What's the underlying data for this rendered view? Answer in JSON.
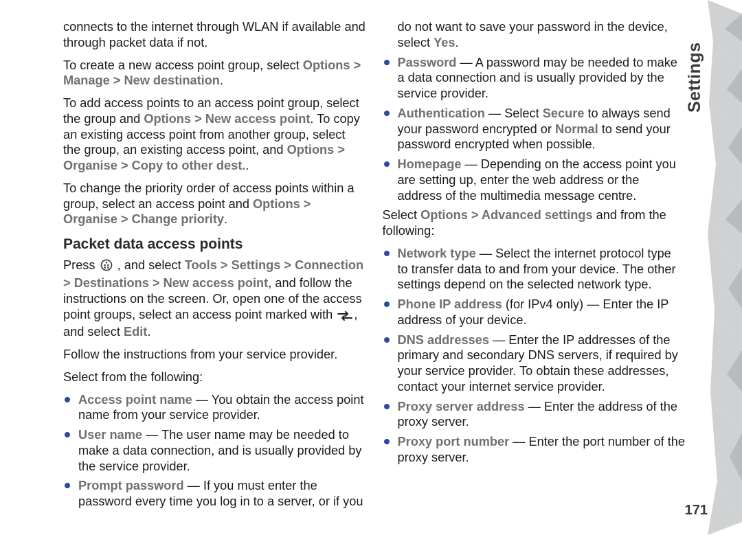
{
  "tab_label": "Settings",
  "page_number": "171",
  "left": {
    "p1": "connects to the internet through WLAN if available and through packet data if not.",
    "p2a": "To create a new access point group, select ",
    "p2b": "Options",
    "p2c": "Manage",
    "p2d": "New destination",
    "p2e": ".",
    "p3a": "To add access points to an access point group, select the group and ",
    "p3b": "Options",
    "p3c": "New access point",
    "p3d": ". To copy an existing access point from another group, select the group, an existing access point, and ",
    "p3e": "Options",
    "p3f": "Organise",
    "p3g": "Copy to other dest.",
    "p3h": ".",
    "p4a": "To change the priority order of access points within a group, select an access point and ",
    "p4b": "Options",
    "p4c": "Organise",
    "p4d": "Change priority",
    "p4e": ".",
    "h1": "Packet data access points",
    "p5a": "Press ",
    "p5b": " , and select ",
    "p5c": "Tools",
    "p5d": "Settings",
    "p5e": "Connection",
    "p5f": "Destinations",
    "p5g": "New access point",
    "p5h": ", and follow the instructions on the screen. Or, open one of the access point groups, select an access point marked with ",
    "p5i": ", and select ",
    "p5j": "Edit",
    "p5k": ".",
    "p6": "Follow the instructions from your service provider.",
    "p7": "Select from the following:",
    "li1a": "Access point name",
    "li1b": " — You obtain the access point name from your service provider.",
    "li2a": "User name",
    "li2b": " — The user name may be needed to make a data connection, and is usually provided by the service provider.",
    "li3a": "Prompt password",
    "li3b": " — If you must enter the password every time you log in to a server, or if you do not want to save your password in the device, select ",
    "li3c": "Yes",
    "li3d": "."
  },
  "right": {
    "li4a": "Password",
    "li4b": " — A password may be needed to make a data connection and is usually provided by the service provider.",
    "li5a": "Authentication",
    "li5b": " — Select ",
    "li5c": "Secure",
    "li5d": " to always send your password encrypted or ",
    "li5e": "Normal",
    "li5f": " to send your password encrypted when possible.",
    "li6a": "Homepage",
    "li6b": " — Depending on the access point you are setting up, enter the web address or the address of the multimedia message centre.",
    "p8a": "Select ",
    "p8b": "Options",
    "p8c": "Advanced settings",
    "p8d": " and from the following:",
    "li7a": "Network type",
    "li7b": " — Select the internet protocol type to transfer data to and from your device. The other settings depend on the selected network type.",
    "li8a": "Phone IP address",
    "li8b": " (for IPv4 only) — Enter the IP address of your device.",
    "li9a": "DNS addresses",
    "li9b": " — Enter the IP addresses of the primary and secondary DNS servers, if required by your service provider. To obtain these addresses, contact your internet service provider.",
    "li10a": "Proxy server address",
    "li10b": " — Enter the address of the proxy server.",
    "li11a": "Proxy port number",
    "li11b": " — Enter the port number of the proxy server."
  },
  "gt": ">"
}
